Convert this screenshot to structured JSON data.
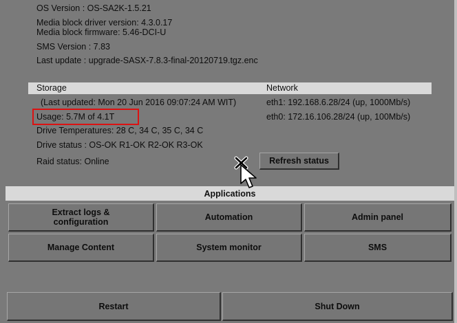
{
  "system": {
    "os_version": "OS Version : OS-SA2K-1.5.21",
    "media_block_driver": "Media block driver version: 4.3.0.17",
    "media_block_firmware": "Media block firmware: 5.46-DCI-U",
    "sms_version": "SMS Version : 7.83",
    "last_update": "Last update : upgrade-SASX-7.8.3-final-20120719.tgz.enc"
  },
  "storage": {
    "header": "Storage",
    "last_updated": "(Last updated: Mon 20 Jun 2016 09:07:24 AM WIT)",
    "usage": "Usage: 5.7M of 4.1T",
    "drive_temps": "Drive Temperatures: 28 C, 34 C, 35 C, 34 C",
    "drive_status": "Drive status : OS-OK  R1-OK  R2-OK  R3-OK",
    "raid_status": "Raid status: Online"
  },
  "network": {
    "header": "Network",
    "eth1": "eth1: 192.168.6.28/24 (up, 1000Mb/s)",
    "eth0": "eth0: 172.16.106.28/24 (up, 100Mb/s)"
  },
  "buttons": {
    "refresh": "Refresh status",
    "extract_logs": "Extract logs &\nconfiguration",
    "automation": "Automation",
    "admin_panel": "Admin panel",
    "manage_content": "Manage Content",
    "system_monitor": "System monitor",
    "sms": "SMS",
    "restart": "Restart",
    "shut_down": "Shut Down"
  },
  "applications_header": "Applications",
  "colors": {
    "panel_bg": "#7a7a7a",
    "header_bar": "#d9d9d9",
    "highlight_box": "#dd1111"
  },
  "icons": [
    "x-cursor-icon",
    "arrow-cursor-icon"
  ]
}
